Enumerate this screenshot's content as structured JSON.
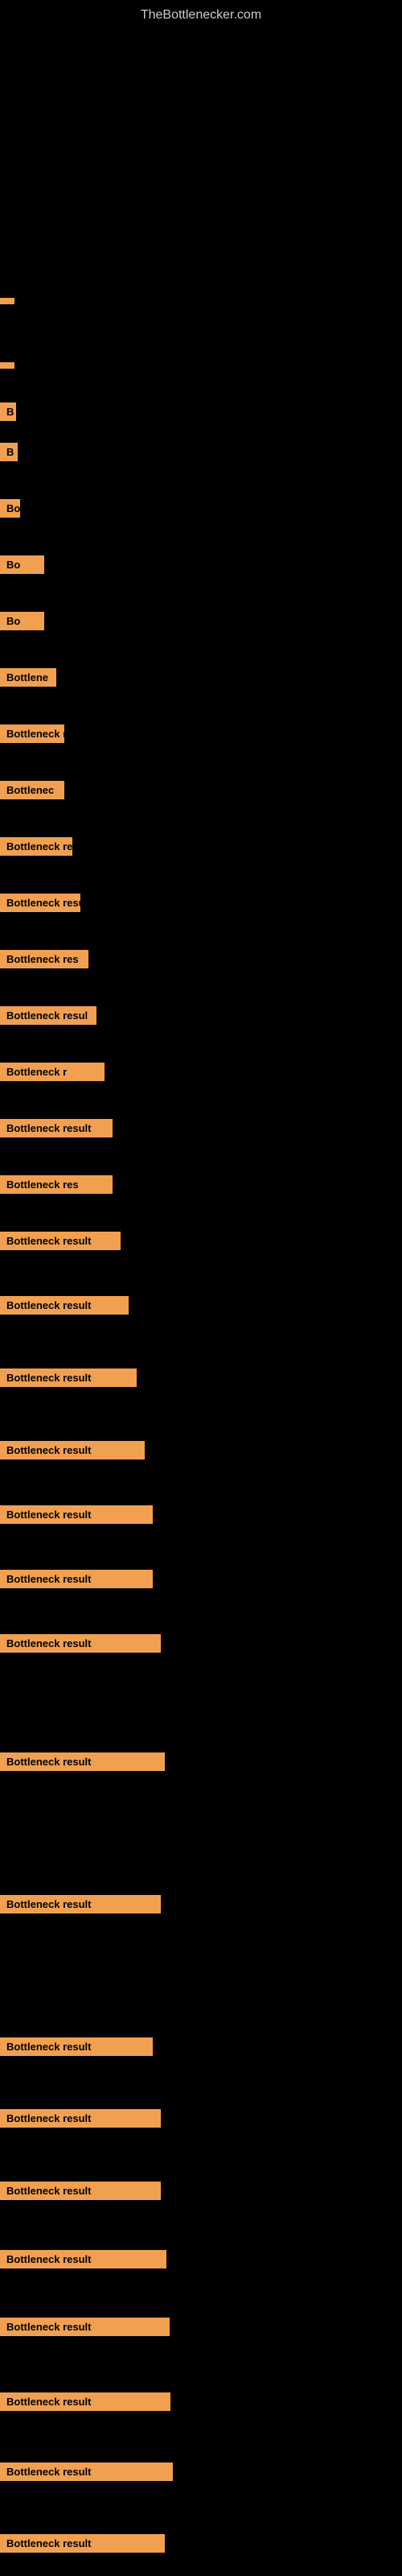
{
  "site": {
    "title": "TheBottlenecker.com"
  },
  "items": [
    {
      "id": 1,
      "label": "",
      "width_class": "w-tiny",
      "position_class": "item-1"
    },
    {
      "id": 2,
      "label": "",
      "width_class": "w-tiny",
      "position_class": "item-2"
    },
    {
      "id": 3,
      "label": "B",
      "width_class": "w-small1",
      "position_class": "item-3"
    },
    {
      "id": 4,
      "label": "B",
      "width_class": "w-small2",
      "position_class": "item-4"
    },
    {
      "id": 5,
      "label": "Bo",
      "width_class": "w-small3",
      "position_class": "item-5"
    },
    {
      "id": 6,
      "label": "Bo",
      "width_class": "w-med1",
      "position_class": "item-6"
    },
    {
      "id": 7,
      "label": "Bo",
      "width_class": "w-med1",
      "position_class": "item-7"
    },
    {
      "id": 8,
      "label": "Bottlene",
      "width_class": "w-med2",
      "position_class": "item-8"
    },
    {
      "id": 9,
      "label": "Bottleneck r",
      "width_class": "w-med3",
      "position_class": "item-9"
    },
    {
      "id": 10,
      "label": "Bottlenec",
      "width_class": "w-med3",
      "position_class": "item-10"
    },
    {
      "id": 11,
      "label": "Bottleneck res",
      "width_class": "w-med4",
      "position_class": "item-11"
    },
    {
      "id": 12,
      "label": "Bottleneck result",
      "width_class": "w-large1",
      "position_class": "item-12"
    },
    {
      "id": 13,
      "label": "Bottleneck res",
      "width_class": "w-large2",
      "position_class": "item-13"
    },
    {
      "id": 14,
      "label": "Bottleneck resul",
      "width_class": "w-large3",
      "position_class": "item-14"
    },
    {
      "id": 15,
      "label": "Bottleneck r",
      "width_class": "w-large4",
      "position_class": "item-15"
    },
    {
      "id": 16,
      "label": "Bottleneck result",
      "width_class": "w-large5",
      "position_class": "item-16"
    },
    {
      "id": 17,
      "label": "Bottleneck res",
      "width_class": "w-large5",
      "position_class": "item-17"
    },
    {
      "id": 18,
      "label": "Bottleneck result",
      "width_class": "w-large6",
      "position_class": "item-18"
    },
    {
      "id": 19,
      "label": "Bottleneck result",
      "width_class": "w-large7",
      "position_class": "item-19"
    },
    {
      "id": 20,
      "label": "Bottleneck result",
      "width_class": "w-large8",
      "position_class": "item-20"
    },
    {
      "id": 21,
      "label": "Bottleneck result",
      "width_class": "w-large9",
      "position_class": "item-21"
    },
    {
      "id": 22,
      "label": "Bottleneck result",
      "width_class": "w-full1",
      "position_class": "item-22"
    },
    {
      "id": 23,
      "label": "Bottleneck result",
      "width_class": "w-full1",
      "position_class": "item-23"
    },
    {
      "id": 24,
      "label": "Bottleneck result",
      "width_class": "w-full2",
      "position_class": "item-24"
    },
    {
      "id": 25,
      "label": "Bottleneck result",
      "width_class": "w-full3",
      "position_class": "item-25"
    },
    {
      "id": 26,
      "label": "Bottleneck result",
      "width_class": "w-full2",
      "position_class": "item-26"
    },
    {
      "id": 27,
      "label": "Bottleneck result",
      "width_class": "w-full1",
      "position_class": "item-27"
    },
    {
      "id": 28,
      "label": "Bottleneck result",
      "width_class": "w-full2",
      "position_class": "item-28"
    },
    {
      "id": 29,
      "label": "Bottleneck result",
      "width_class": "w-full2",
      "position_class": "item-29"
    },
    {
      "id": 30,
      "label": "Bottleneck result",
      "width_class": "w-full4",
      "position_class": "item-30"
    },
    {
      "id": 31,
      "label": "Bottleneck result",
      "width_class": "w-full5",
      "position_class": "item-31"
    },
    {
      "id": 32,
      "label": "Bottleneck result",
      "width_class": "w-full6",
      "position_class": "item-32"
    },
    {
      "id": 33,
      "label": "Bottleneck result",
      "width_class": "w-full7",
      "position_class": "item-33"
    },
    {
      "id": 34,
      "label": "Bottleneck result",
      "width_class": "w-full3",
      "position_class": "item-34"
    }
  ]
}
